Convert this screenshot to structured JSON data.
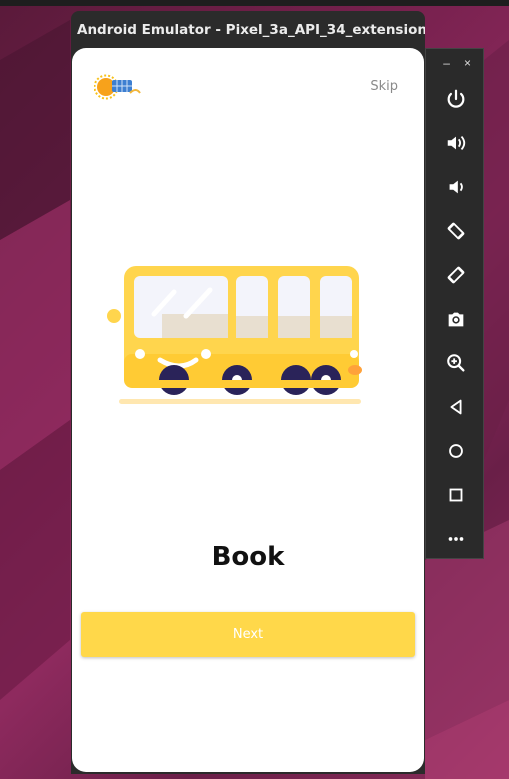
{
  "window": {
    "title": "Android Emulator - Pixel_3a_API_34_extension..."
  },
  "app": {
    "skip_label": "Skip",
    "page_title": "Book",
    "next_label": "Next",
    "accent_color": "#ffd84a"
  },
  "side_toolbar": {
    "minimize": "–",
    "close": "×",
    "tools": [
      "power-icon",
      "volume-up-icon",
      "volume-down-icon",
      "rotate-left-icon",
      "rotate-right-icon",
      "camera-icon",
      "zoom-icon",
      "back-icon",
      "home-icon",
      "overview-icon",
      "more-icon"
    ]
  }
}
